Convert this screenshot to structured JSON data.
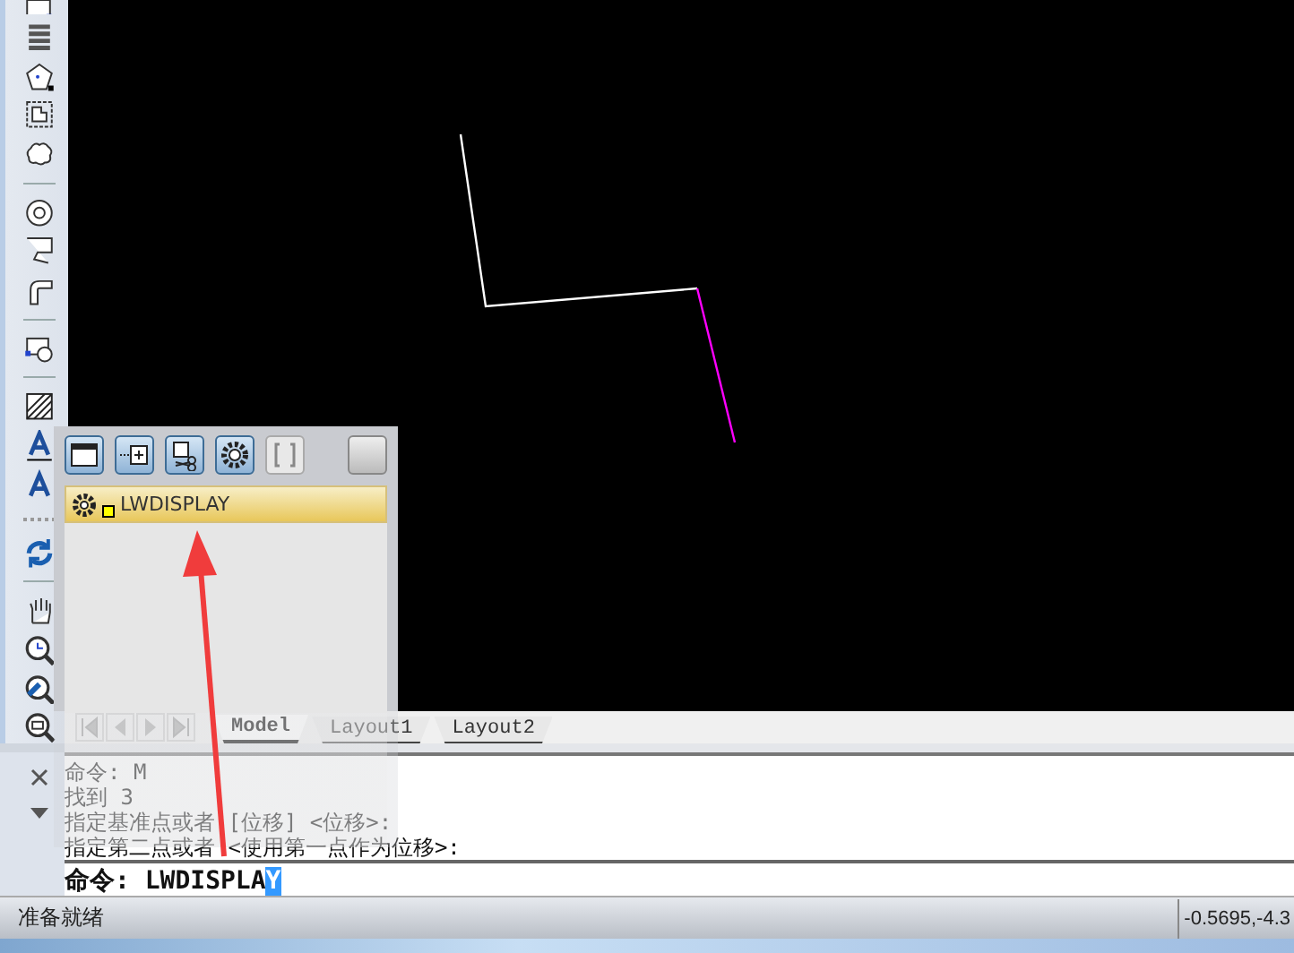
{
  "layout_tabs": [
    {
      "label": "Model",
      "selected": true
    },
    {
      "label": "Layout1",
      "selected": false
    },
    {
      "label": "Layout2",
      "selected": false
    }
  ],
  "command_history": [
    "命令: M",
    "找到 3",
    "指定基准点或者 [位移] <位移>:",
    "指定第二点或者 <使用第一点作为位移>:"
  ],
  "command_line": {
    "prompt": "命令:",
    "typed": "LWDISPLA",
    "selected_text": "Y"
  },
  "autocomplete": {
    "toolbar": [
      {
        "kind": "window",
        "disabled": false
      },
      {
        "kind": "insert",
        "disabled": false
      },
      {
        "kind": "cut",
        "disabled": false
      },
      {
        "kind": "settings",
        "disabled": false
      },
      {
        "kind": "brackets",
        "disabled": true
      },
      {
        "kind": "blank",
        "disabled": false
      }
    ],
    "items": [
      {
        "label": "LWDISPLAY",
        "selected": true
      }
    ]
  },
  "status_bar": {
    "message": "准备就绪",
    "coordinates": "-0.5695,-4.3"
  }
}
